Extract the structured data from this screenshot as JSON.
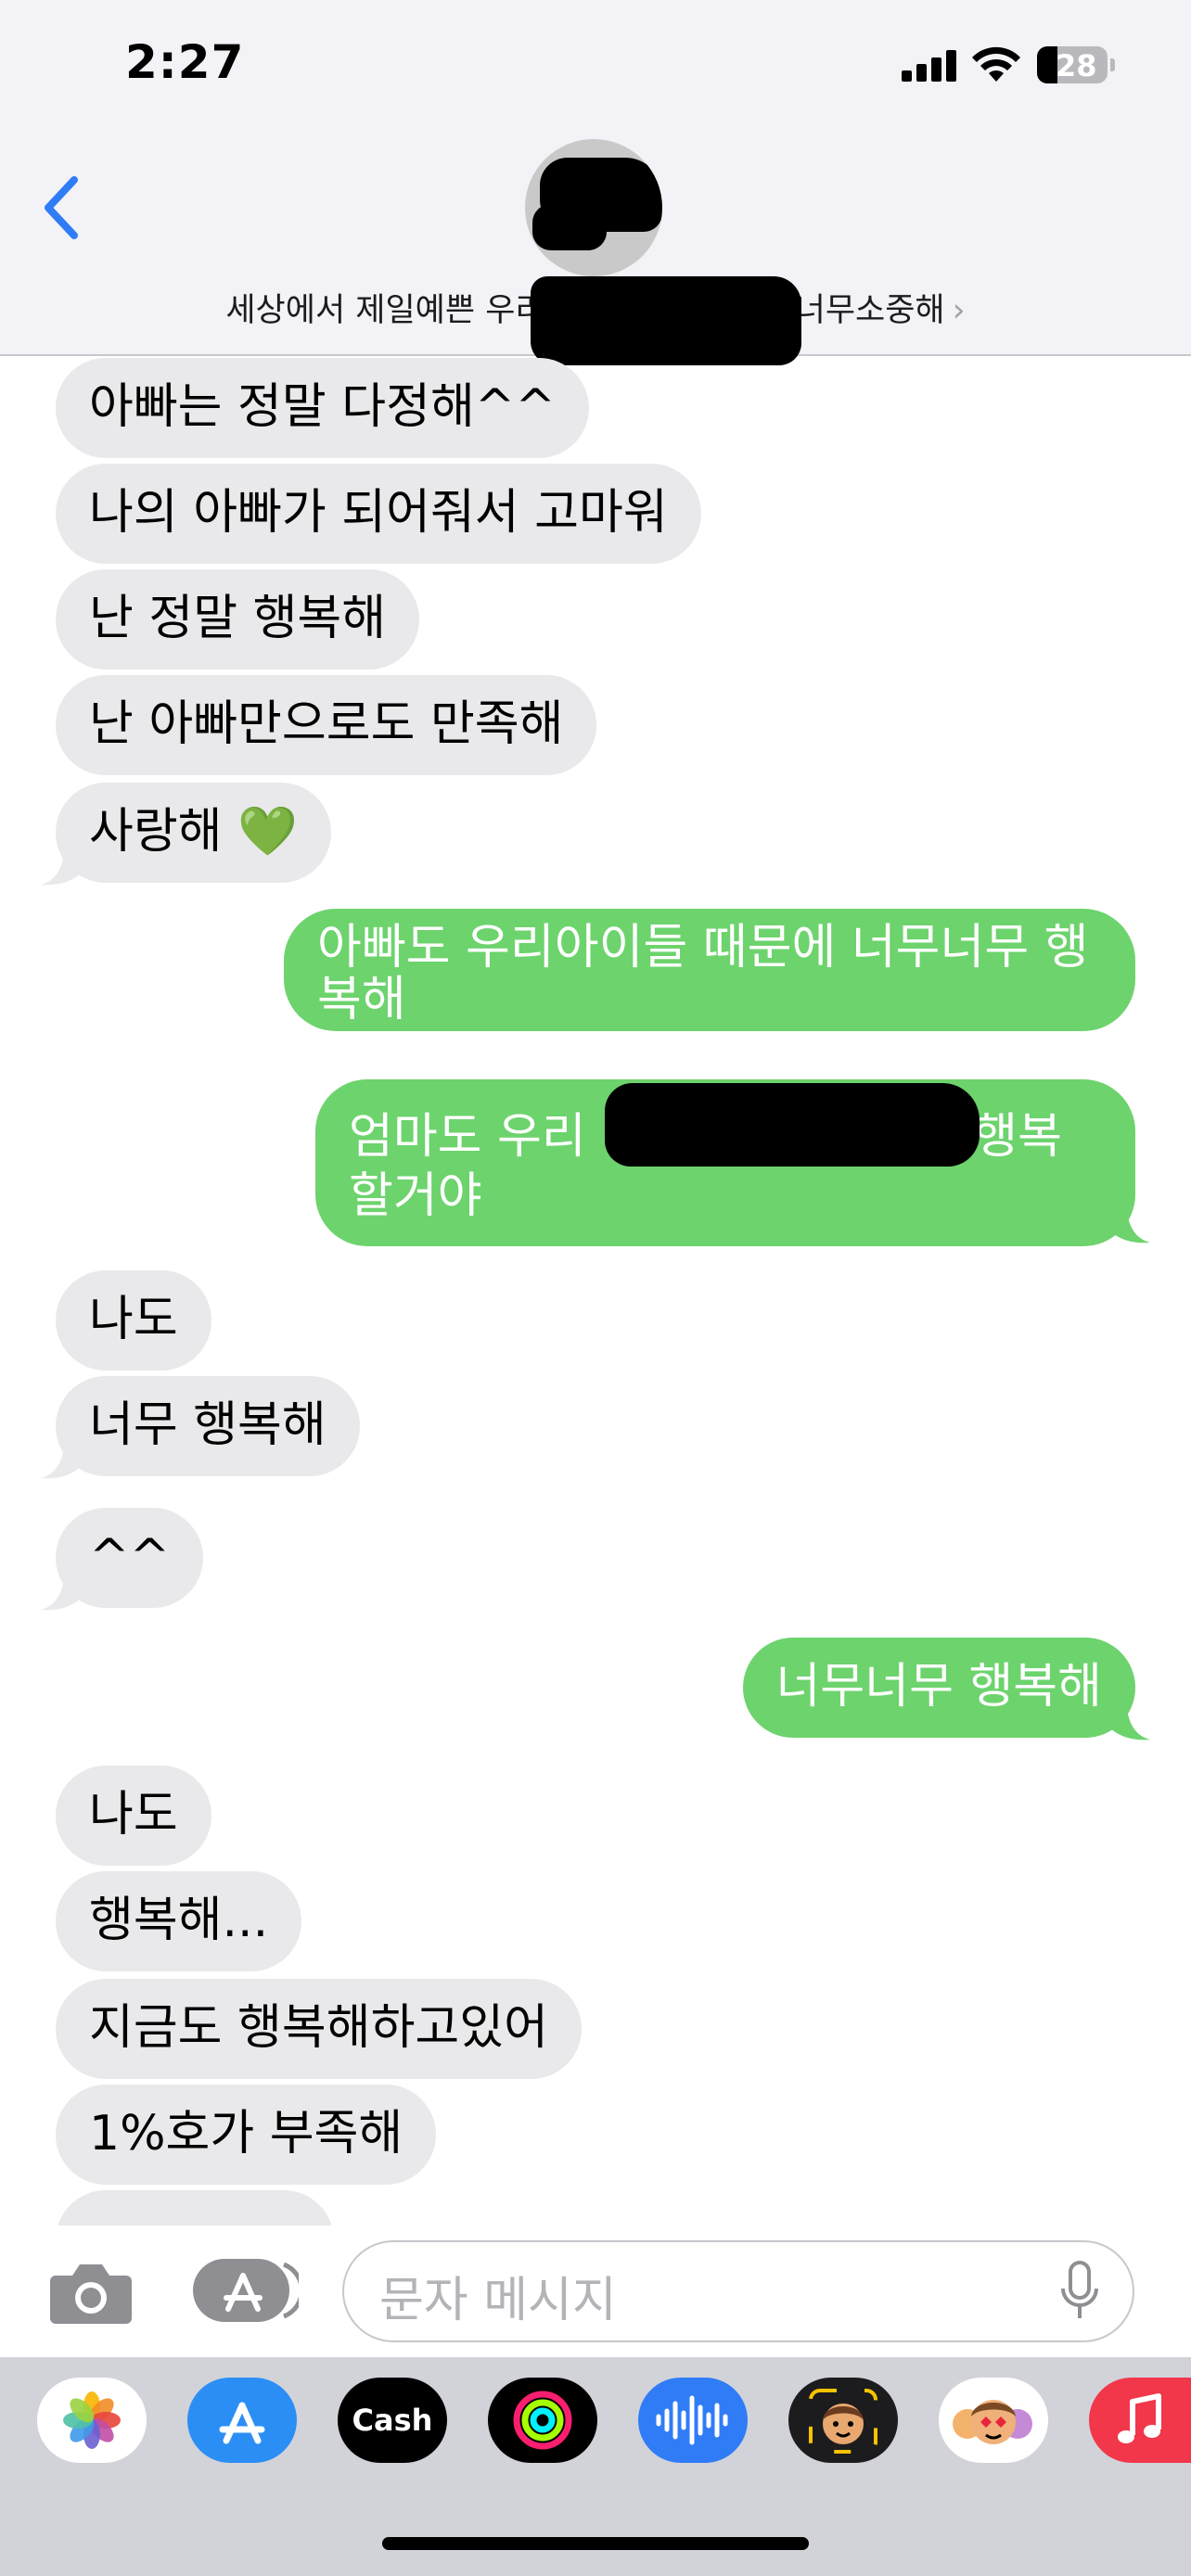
{
  "status_bar": {
    "time": "2:27",
    "battery": "28"
  },
  "header": {
    "contact_name": "세상에서 제일예쁜 우리",
    "contact_name_suffix": "너무소중해",
    "chevron": "›"
  },
  "messages": [
    {
      "dir": "in",
      "text": "아빠는 정말 다정해^^"
    },
    {
      "dir": "in",
      "text": "나의 아빠가 되어줘서 고마워"
    },
    {
      "dir": "in",
      "text": "난 정말 행복해"
    },
    {
      "dir": "in",
      "text": "난 아빠만으로도 만족해"
    },
    {
      "dir": "in",
      "text": "사랑해 💚"
    },
    {
      "dir": "out",
      "text": "아빠도 우리아이들 때문에 너무너무 행복해"
    },
    {
      "dir": "out",
      "text": "엄마도 우리 ㅅ 가 있어서 너무 행복할거야"
    },
    {
      "dir": "in",
      "text": "나도"
    },
    {
      "dir": "in",
      "text": "너무 행복해"
    },
    {
      "dir": "in",
      "text": "^^"
    },
    {
      "dir": "out",
      "text": "너무너무 행복해"
    },
    {
      "dir": "in",
      "text": "나도"
    },
    {
      "dir": "in",
      "text": "행복해..."
    },
    {
      "dir": "in",
      "text": "지금도 행복해하고있어"
    },
    {
      "dir": "in",
      "text": "1%호가 부족해"
    },
    {
      "dir": "in",
      "text": ""
    }
  ],
  "input": {
    "placeholder": "문자 메시지"
  },
  "apps": [
    {
      "name": "photos-app-icon"
    },
    {
      "name": "app-store-app-icon"
    },
    {
      "name": "apple-cash-app-icon",
      "label": "Cash"
    },
    {
      "name": "activity-app-icon"
    },
    {
      "name": "audio-message-app-icon"
    },
    {
      "name": "memoji-app-icon"
    },
    {
      "name": "memoji-stickers-app-icon"
    },
    {
      "name": "music-app-icon"
    }
  ],
  "colors": {
    "outgoing": "#6dd36d",
    "incoming": "#e9e9eb",
    "accent": "#2f7cf6"
  }
}
